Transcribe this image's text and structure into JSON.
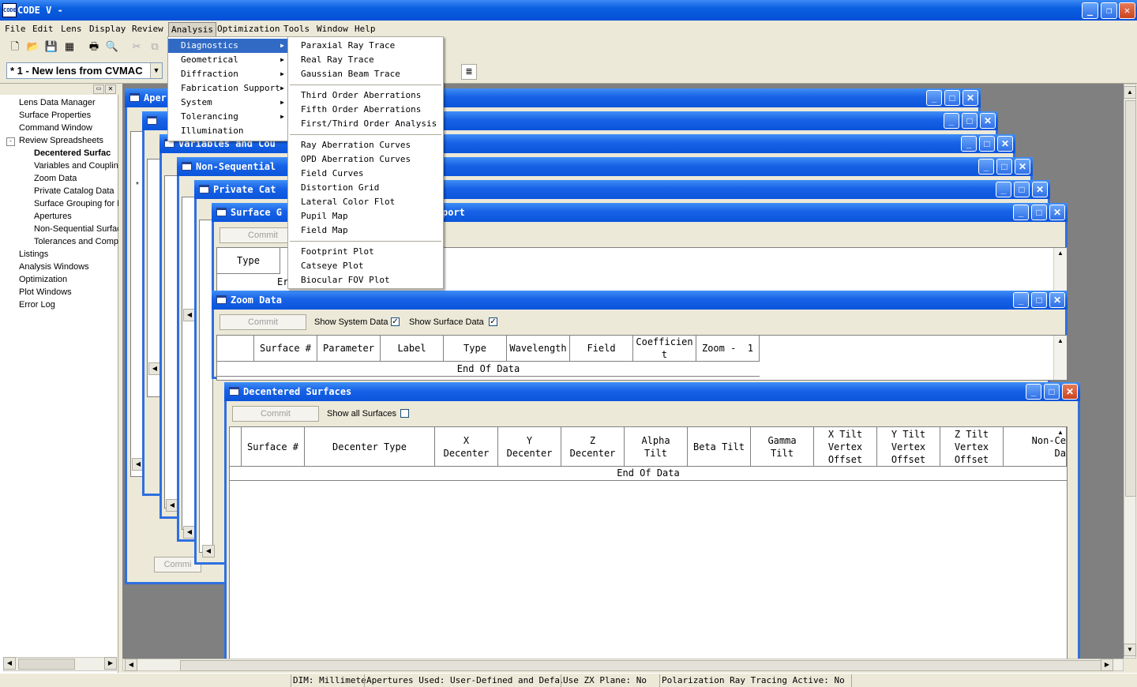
{
  "app": {
    "title": "CODE V -",
    "icon_text": "CODE"
  },
  "menubar": [
    "File",
    "Edit",
    "Lens",
    "Display",
    "Review",
    "Analysis",
    "Optimization",
    "Tools",
    "Window",
    "Help"
  ],
  "lens_selector": {
    "value": "*  1 - New lens from CVMAC"
  },
  "tree": {
    "items": [
      "Lens Data Manager",
      "Surface Properties",
      "Command Window",
      "Review Spreadsheets"
    ],
    "children": [
      "Decentered Surfac",
      "Variables and Coupling",
      "Zoom Data",
      "Private Catalog Data",
      "Surface Grouping for L",
      "Apertures",
      "Non-Sequential Surfac",
      "Tolerances and Comp"
    ],
    "items_after": [
      "Listings",
      "Analysis Windows",
      "Optimization",
      "Plot Windows",
      "Error Log"
    ],
    "selected": "Decentered Surfac",
    "expander": "-"
  },
  "windows": {
    "apertures": "Aper",
    "variables": "Variables and Cou",
    "nonseq": "Non-Sequential",
    "private": "Private Cat",
    "grouping_left": "Surface G",
    "grouping_right": "port",
    "zoom": "Zoom Data",
    "decentered": "Decentered Surfaces"
  },
  "commit_label": "Commit",
  "commit_partial": "Commi",
  "grouping": {
    "col_type": "Type",
    "row_text": "Er"
  },
  "zoom": {
    "show_system": "Show System Data",
    "show_surface": "Show Surface Data",
    "columns": [
      "",
      "Surface #",
      "Parameter",
      "Label",
      "Type",
      "Wavelength",
      "Field",
      "Coefficient",
      "Zoom -  1"
    ],
    "end": "End Of Data"
  },
  "decentered": {
    "show_all": "Show all Surfaces",
    "columns": [
      "",
      "Surface #",
      "Decenter Type",
      "X\nDecenter",
      "Y\nDecenter",
      "Z\nDecenter",
      "Alpha\nTilt",
      "Beta Tilt",
      "Gamma\nTilt",
      "X Tilt\nVertex\nOffset",
      "Y Tilt\nVertex\nOffset",
      "Z Tilt\nVertex\nOffset",
      "Non-Ce\nDa"
    ],
    "end": "End Of Data"
  },
  "analysis_menu": [
    "Diagnostics",
    "Geometrical",
    "Diffraction",
    "Fabrication Support",
    "System",
    "Tolerancing",
    "Illumination"
  ],
  "diagnostics_menu": {
    "group1": [
      "Paraxial Ray Trace",
      "Real Ray Trace",
      "Gaussian Beam Trace"
    ],
    "group2": [
      "Third Order Aberrations",
      "Fifth Order Aberrations",
      "First/Third Order Analysis"
    ],
    "group3": [
      "Ray Aberration Curves",
      "OPD Aberration Curves",
      "Field Curves",
      "Distortion Grid",
      "Lateral Color Flot",
      "Pupil Map",
      "Field Map"
    ],
    "group4": [
      "Footprint Plot",
      "Catseye Plot",
      "Biocular FOV Plot"
    ]
  },
  "statusbar": [
    "DIM: Millimeter",
    "Apertures Used: User-Defined and Default",
    "Use ZX Plane: No",
    "Polarization Ray Tracing Active: No"
  ],
  "icons": [
    "new-file-icon",
    "open-folder-icon",
    "save-icon",
    "image-icon",
    "print-icon",
    "print-preview-icon",
    "cut-icon",
    "copy-icon",
    "document-icon",
    "minimize-icon",
    "maximize-icon",
    "close-icon",
    "restore-icon",
    "checkmark-icon"
  ]
}
